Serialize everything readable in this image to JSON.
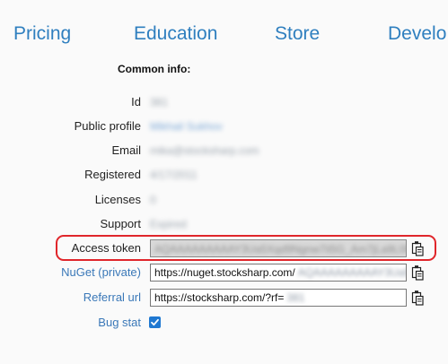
{
  "nav": {
    "items": [
      "Pricing",
      "Education",
      "Store",
      "Develo"
    ]
  },
  "section_title": "Common info:",
  "fields": {
    "id": {
      "label": "Id",
      "value": "381"
    },
    "public_profile": {
      "label": "Public profile",
      "value": "Mikhail Sukhov"
    },
    "email": {
      "label": "Email",
      "value": "mika@stocksharp.com"
    },
    "registered": {
      "label": "Registered",
      "value": "4/17/2011"
    },
    "licenses": {
      "label": "Licenses",
      "value": "0"
    },
    "support": {
      "label": "Support",
      "value": "Expired"
    },
    "access_token": {
      "label": "Access token",
      "value": "AQAAAAAAAAAY3Ua5Xqd9Ngnw7ii5G_Am7jLa9L0Pn"
    },
    "nuget": {
      "label": "NuGet (private)",
      "value_prefix": "https://nuget.stocksharp.com/",
      "value_secret": "AQAAAAAAAAAY3Ua5Xqd9"
    },
    "referral": {
      "label": "Referral url",
      "value_prefix": "https://stocksharp.com/?rf=",
      "value_secret": "381"
    },
    "bug_stat": {
      "label": "Bug stat",
      "checked": true
    }
  },
  "icons": {
    "copy": "clipboard-copy-icon"
  },
  "colors": {
    "link": "#2f7fbf",
    "highlight": "#e0262b",
    "checkbox": "#1f78d1"
  }
}
